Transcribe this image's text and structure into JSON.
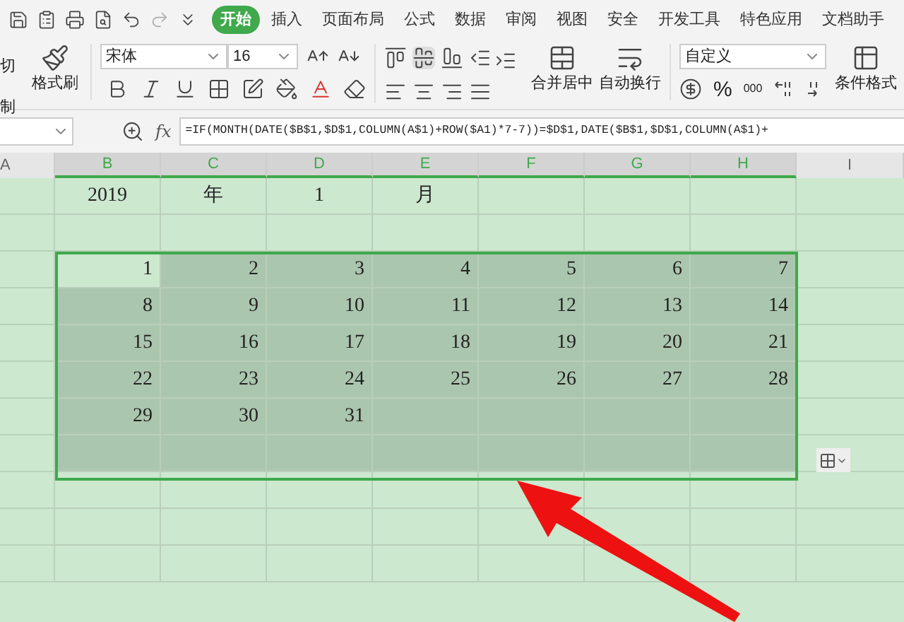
{
  "menu_tabs": [
    {
      "label": "开始",
      "selected": true
    },
    {
      "label": "插入",
      "selected": false
    },
    {
      "label": "页面布局",
      "selected": false
    },
    {
      "label": "公式",
      "selected": false
    },
    {
      "label": "数据",
      "selected": false
    },
    {
      "label": "审阅",
      "selected": false
    },
    {
      "label": "视图",
      "selected": false
    },
    {
      "label": "安全",
      "selected": false
    },
    {
      "label": "开发工具",
      "selected": false
    },
    {
      "label": "特色应用",
      "selected": false
    },
    {
      "label": "文档助手",
      "selected": false
    }
  ],
  "toolbar": {
    "clipboard": [
      "切",
      "制"
    ],
    "format_painter": "格式刷",
    "font_name": "宋体",
    "font_size": "16",
    "merge_center": "合并居中",
    "wrap_text": "自动换行",
    "number_format": "自定义",
    "percent": "%",
    "thousands": "000",
    "conditional_format": "条件格式"
  },
  "formula_bar": {
    "fx_label": "fx",
    "formula": "=IF(MONTH(DATE($B$1,$D$1,COLUMN(A$1)+ROW($A1)*7-7))=$D$1,DATE($B$1,$D$1,COLUMN(A$1)+"
  },
  "columns": [
    {
      "label": "A",
      "selected": false
    },
    {
      "label": "B",
      "selected": true
    },
    {
      "label": "C",
      "selected": true
    },
    {
      "label": "D",
      "selected": true
    },
    {
      "label": "E",
      "selected": true
    },
    {
      "label": "F",
      "selected": true
    },
    {
      "label": "G",
      "selected": true
    },
    {
      "label": "H",
      "selected": true
    },
    {
      "label": "I",
      "selected": false
    }
  ],
  "rows": [
    {
      "kind": "title",
      "selected": false,
      "cells": [
        {
          "text": "2019"
        },
        {
          "text": "年"
        },
        {
          "text": "1"
        },
        {
          "text": "月"
        },
        {},
        {},
        {}
      ]
    },
    {
      "kind": "blank",
      "selected": false,
      "cells": [
        {},
        {},
        {},
        {},
        {},
        {},
        {}
      ]
    },
    {
      "kind": "dates",
      "selected": true,
      "cells": [
        {
          "text": "1",
          "active": true
        },
        {
          "text": "2",
          "active": false
        },
        {
          "text": "3",
          "active": false
        },
        {
          "text": "4",
          "active": false
        },
        {
          "text": "5",
          "active": false
        },
        {
          "text": "6",
          "active": false
        },
        {
          "text": "7",
          "active": false
        }
      ]
    },
    {
      "kind": "dates",
      "selected": true,
      "cells": [
        {
          "text": "8",
          "active": false
        },
        {
          "text": "9",
          "active": false
        },
        {
          "text": "10",
          "active": false
        },
        {
          "text": "11",
          "active": false
        },
        {
          "text": "12",
          "active": false
        },
        {
          "text": "13",
          "active": false
        },
        {
          "text": "14",
          "active": false
        }
      ]
    },
    {
      "kind": "dates",
      "selected": true,
      "cells": [
        {
          "text": "15",
          "active": false
        },
        {
          "text": "16",
          "active": false
        },
        {
          "text": "17",
          "active": false
        },
        {
          "text": "18",
          "active": false
        },
        {
          "text": "19",
          "active": false
        },
        {
          "text": "20",
          "active": false
        },
        {
          "text": "21",
          "active": false
        }
      ]
    },
    {
      "kind": "dates",
      "selected": true,
      "cells": [
        {
          "text": "22",
          "active": false
        },
        {
          "text": "23",
          "active": false
        },
        {
          "text": "24",
          "active": false
        },
        {
          "text": "25",
          "active": false
        },
        {
          "text": "26",
          "active": false
        },
        {
          "text": "27",
          "active": false
        },
        {
          "text": "28",
          "active": false
        }
      ]
    },
    {
      "kind": "dates",
      "selected": true,
      "cells": [
        {
          "text": "29",
          "active": false
        },
        {
          "text": "30",
          "active": false
        },
        {
          "text": "31",
          "active": false
        },
        {
          "active": false
        },
        {
          "active": false
        },
        {
          "active": false
        },
        {
          "active": false
        }
      ]
    },
    {
      "kind": "dates",
      "selected": true,
      "cells": [
        {
          "active": false
        },
        {
          "active": false
        },
        {
          "active": false
        },
        {
          "active": false
        },
        {
          "active": false
        },
        {
          "active": false
        },
        {
          "active": false
        }
      ]
    },
    {
      "kind": "blank",
      "selected": false,
      "cells": [
        {},
        {},
        {},
        {},
        {},
        {},
        {}
      ]
    },
    {
      "kind": "blank",
      "selected": false,
      "cells": [
        {},
        {},
        {},
        {},
        {},
        {},
        {}
      ]
    },
    {
      "kind": "blank",
      "selected": false,
      "cells": [
        {},
        {},
        {},
        {},
        {},
        {},
        {}
      ]
    }
  ]
}
